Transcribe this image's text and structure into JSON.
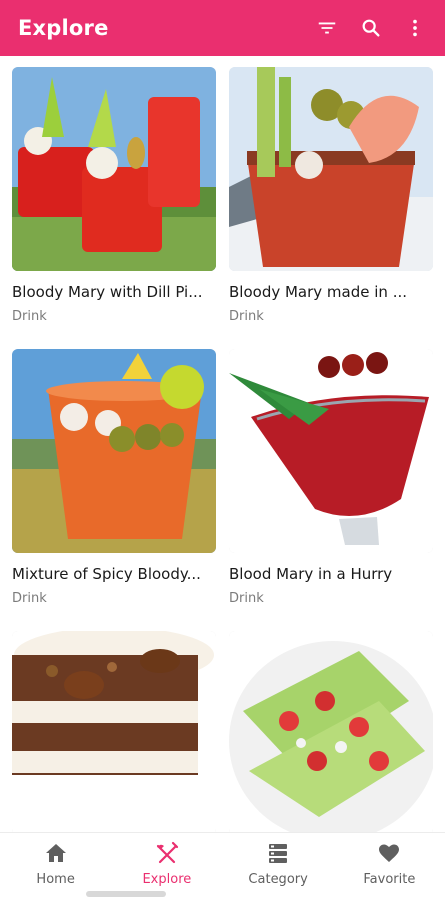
{
  "app_bar": {
    "title": "Explore",
    "icons": [
      "filter-icon",
      "search-icon",
      "more-vert-icon"
    ]
  },
  "recipes": [
    {
      "title": "Bloody Mary with Dill Pi...",
      "category": "Drink"
    },
    {
      "title": "Bloody Mary made in ...",
      "category": "Drink"
    },
    {
      "title": "Mixture of Spicy Bloody...",
      "category": "Drink"
    },
    {
      "title": "Blood Mary in a Hurry",
      "category": "Drink"
    }
  ],
  "bottom_nav": [
    {
      "label": "Home",
      "icon": "home-icon"
    },
    {
      "label": "Explore",
      "icon": "utensils-icon",
      "active": true
    },
    {
      "label": "Category",
      "icon": "category-icon"
    },
    {
      "label": "Favorite",
      "icon": "heart-icon"
    }
  ],
  "colors": {
    "accent": "#ea2f6f",
    "inactive": "#5f5f5f",
    "muted": "#7b7b7b"
  }
}
